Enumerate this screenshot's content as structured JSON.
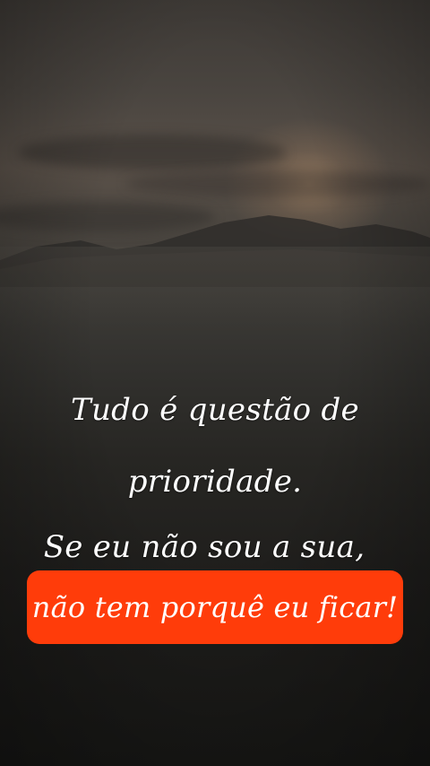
{
  "quote": {
    "line1": "Tudo é questão de",
    "line2": "prioridade.",
    "line3": "Se eu não sou a sua,",
    "line4": "não tem porquê eu ficar!"
  },
  "colors": {
    "highlight": "#ff3c0a",
    "text": "#ffffff"
  }
}
